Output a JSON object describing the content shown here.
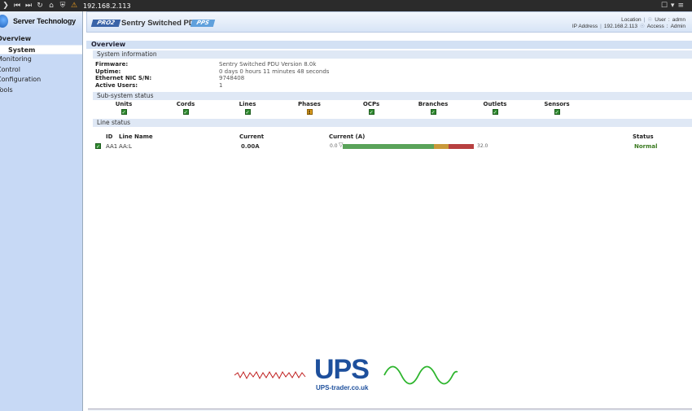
{
  "browser": {
    "url": "192.168.2.113"
  },
  "sidebar": {
    "brand": "Server Technology",
    "items": [
      {
        "label": "Overview",
        "active": true
      },
      {
        "label": "System",
        "sub": true
      },
      {
        "label": "Monitoring"
      },
      {
        "label": "Control"
      },
      {
        "label": "Configuration"
      },
      {
        "label": "Tools"
      }
    ]
  },
  "header": {
    "badge_left": "PRO2",
    "product": "Sentry Switched PDU",
    "badge_right": "PPS",
    "location_label": "Location",
    "user_label": "User",
    "user_value": "admn",
    "ip_label": "IP Address",
    "ip_value": "192.168.2.113",
    "access_label": "Access",
    "access_value": "Admin"
  },
  "panel": {
    "title": "Overview",
    "system_info_title": "System information",
    "info": [
      {
        "label": "Firmware:",
        "value": "Sentry Switched PDU Version 8.0k"
      },
      {
        "label": "Uptime:",
        "value": "0 days 0 hours 11 minutes 48 seconds"
      },
      {
        "label": "Ethernet NIC S/N:",
        "value": "9748408"
      },
      {
        "label": "Active Users:",
        "value": "1"
      }
    ],
    "subsystem_title": "Sub-system status",
    "subsystems": [
      {
        "label": "Units",
        "status": "ok"
      },
      {
        "label": "Cords",
        "status": "ok"
      },
      {
        "label": "Lines",
        "status": "ok"
      },
      {
        "label": "Phases",
        "status": "warn"
      },
      {
        "label": "OCPs",
        "status": "ok"
      },
      {
        "label": "Branches",
        "status": "ok"
      },
      {
        "label": "Outlets",
        "status": "ok"
      },
      {
        "label": "Sensors",
        "status": "ok"
      }
    ],
    "line_status_title": "Line status",
    "line_headers": {
      "id": "ID",
      "name": "Line Name",
      "current": "Current",
      "current_a": "Current (A)",
      "status": "Status"
    },
    "lines": [
      {
        "id": "AA1",
        "name": "AA:L",
        "current": "0.00A",
        "bar_min": "0.0",
        "bar_max": "32.0",
        "status": "Normal",
        "fraction": 0.0
      }
    ]
  },
  "watermark": {
    "text": "UPS",
    "domain": "UPS-trader.co.uk"
  }
}
